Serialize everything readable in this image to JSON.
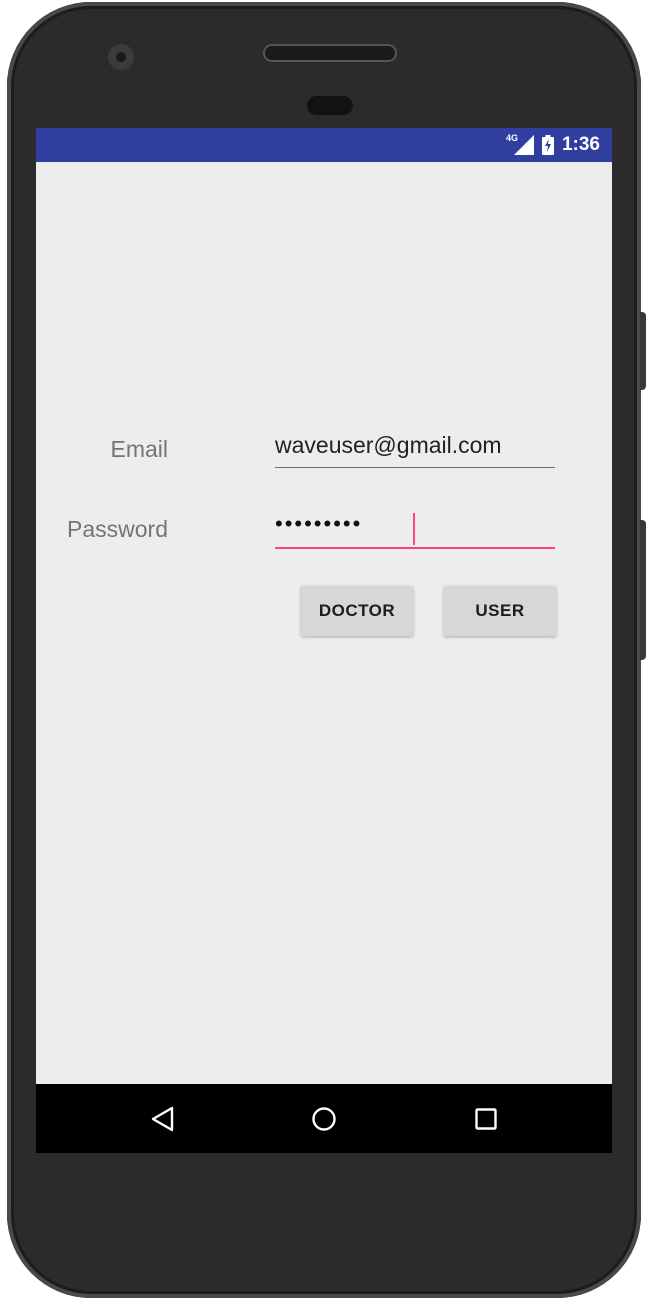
{
  "status_bar": {
    "network_type": "4G",
    "time": "1:36",
    "icons": [
      "signal-icon",
      "battery-charging-icon"
    ],
    "color": "#303f9f"
  },
  "form": {
    "email_label": "Email",
    "email_value": "waveuser@gmail.com",
    "password_label": "Password",
    "password_value": "•••••••••",
    "accent_color": "#ff4081"
  },
  "buttons": {
    "doctor_label": "DOCTOR",
    "user_label": "USER"
  },
  "nav_bar": {
    "icons": [
      "back-icon",
      "home-icon",
      "recents-icon"
    ]
  }
}
